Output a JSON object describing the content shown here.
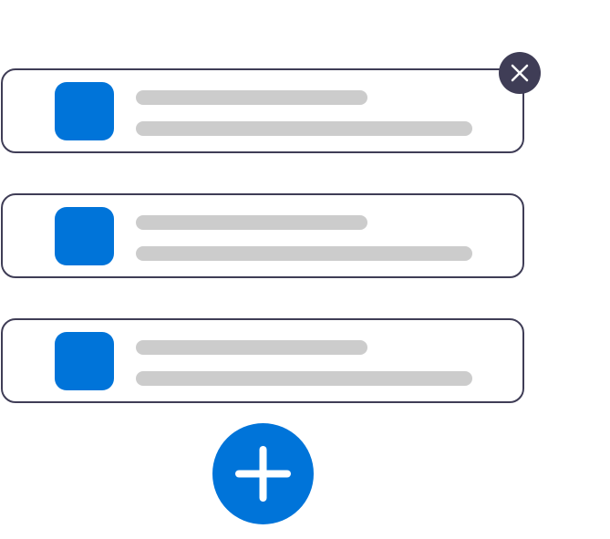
{
  "colors": {
    "accent": "#0074d9",
    "border": "#3f3d56",
    "placeholder": "#cccccc",
    "background": "#ffffff",
    "icon_light": "#ffffff"
  },
  "cards": [
    {
      "icon": "blue-rounded-square",
      "has_remove_button": true
    },
    {
      "icon": "blue-rounded-square",
      "has_remove_button": false
    },
    {
      "icon": "blue-rounded-square",
      "has_remove_button": false
    }
  ],
  "remove_button": {
    "icon": "close-icon"
  },
  "add_button": {
    "icon": "plus-icon"
  }
}
